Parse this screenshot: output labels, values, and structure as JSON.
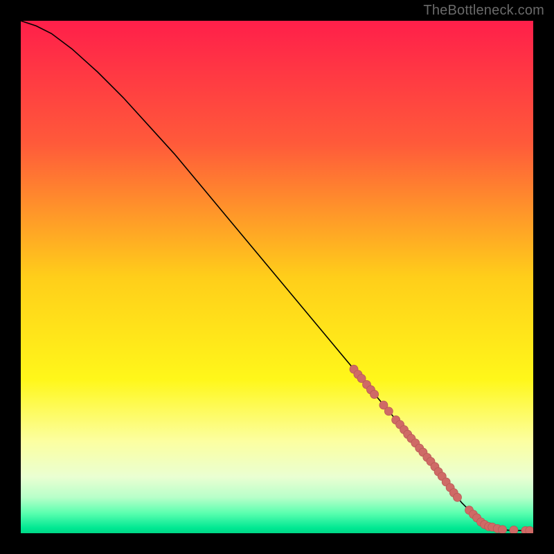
{
  "watermark": "TheBottleneck.com",
  "colors": {
    "background": "#000000",
    "curve": "#000000",
    "marker_fill": "#cf6a66",
    "marker_stroke": "#b85955",
    "gradient_stops": [
      {
        "offset": "0%",
        "color": "#ff1f4a"
      },
      {
        "offset": "24%",
        "color": "#ff5a3a"
      },
      {
        "offset": "50%",
        "color": "#ffce1a"
      },
      {
        "offset": "70%",
        "color": "#fff71a"
      },
      {
        "offset": "82%",
        "color": "#fcffa0"
      },
      {
        "offset": "89%",
        "color": "#eaffd2"
      },
      {
        "offset": "93%",
        "color": "#b8ffc9"
      },
      {
        "offset": "96%",
        "color": "#5dffb0"
      },
      {
        "offset": "99%",
        "color": "#00e892"
      },
      {
        "offset": "100%",
        "color": "#00d787"
      }
    ]
  },
  "chart_data": {
    "type": "line",
    "title": "",
    "xlabel": "",
    "ylabel": "",
    "xlim": [
      0,
      100
    ],
    "ylim": [
      0,
      100
    ],
    "series": [
      {
        "name": "curve",
        "x": [
          0,
          3,
          6,
          10,
          15,
          20,
          25,
          30,
          35,
          40,
          45,
          50,
          55,
          60,
          65,
          70,
          75,
          80,
          83,
          86,
          89,
          92,
          95,
          98,
          100
        ],
        "y": [
          100,
          99,
          97.5,
          94.5,
          90,
          85,
          79.5,
          74,
          68,
          62,
          56,
          50,
          44,
          38,
          32,
          26,
          20,
          14,
          10,
          6,
          3,
          1.2,
          0.6,
          0.5,
          0.5
        ]
      }
    ],
    "markers": [
      {
        "x": 65.0,
        "y": 32.0
      },
      {
        "x": 65.8,
        "y": 31.0
      },
      {
        "x": 66.5,
        "y": 30.2
      },
      {
        "x": 67.5,
        "y": 29.0
      },
      {
        "x": 68.3,
        "y": 28.0
      },
      {
        "x": 69.0,
        "y": 27.1
      },
      {
        "x": 70.8,
        "y": 25.0
      },
      {
        "x": 71.8,
        "y": 23.8
      },
      {
        "x": 73.2,
        "y": 22.1
      },
      {
        "x": 74.0,
        "y": 21.2
      },
      {
        "x": 74.8,
        "y": 20.2
      },
      {
        "x": 75.5,
        "y": 19.3
      },
      {
        "x": 76.2,
        "y": 18.5
      },
      {
        "x": 77.0,
        "y": 17.6
      },
      {
        "x": 77.8,
        "y": 16.6
      },
      {
        "x": 78.5,
        "y": 15.8
      },
      {
        "x": 79.3,
        "y": 14.8
      },
      {
        "x": 80.0,
        "y": 14.0
      },
      {
        "x": 80.8,
        "y": 13.0
      },
      {
        "x": 81.5,
        "y": 12.0
      },
      {
        "x": 82.2,
        "y": 11.1
      },
      {
        "x": 83.0,
        "y": 10.0
      },
      {
        "x": 83.8,
        "y": 8.9
      },
      {
        "x": 84.5,
        "y": 7.9
      },
      {
        "x": 85.2,
        "y": 7.0
      },
      {
        "x": 87.5,
        "y": 4.5
      },
      {
        "x": 88.3,
        "y": 3.7
      },
      {
        "x": 89.0,
        "y": 3.0
      },
      {
        "x": 89.8,
        "y": 2.2
      },
      {
        "x": 90.5,
        "y": 1.7
      },
      {
        "x": 91.3,
        "y": 1.3
      },
      {
        "x": 92.0,
        "y": 1.2
      },
      {
        "x": 93.0,
        "y": 0.9
      },
      {
        "x": 94.0,
        "y": 0.7
      },
      {
        "x": 96.2,
        "y": 0.6
      },
      {
        "x": 98.5,
        "y": 0.5
      },
      {
        "x": 99.3,
        "y": 0.5
      }
    ]
  }
}
